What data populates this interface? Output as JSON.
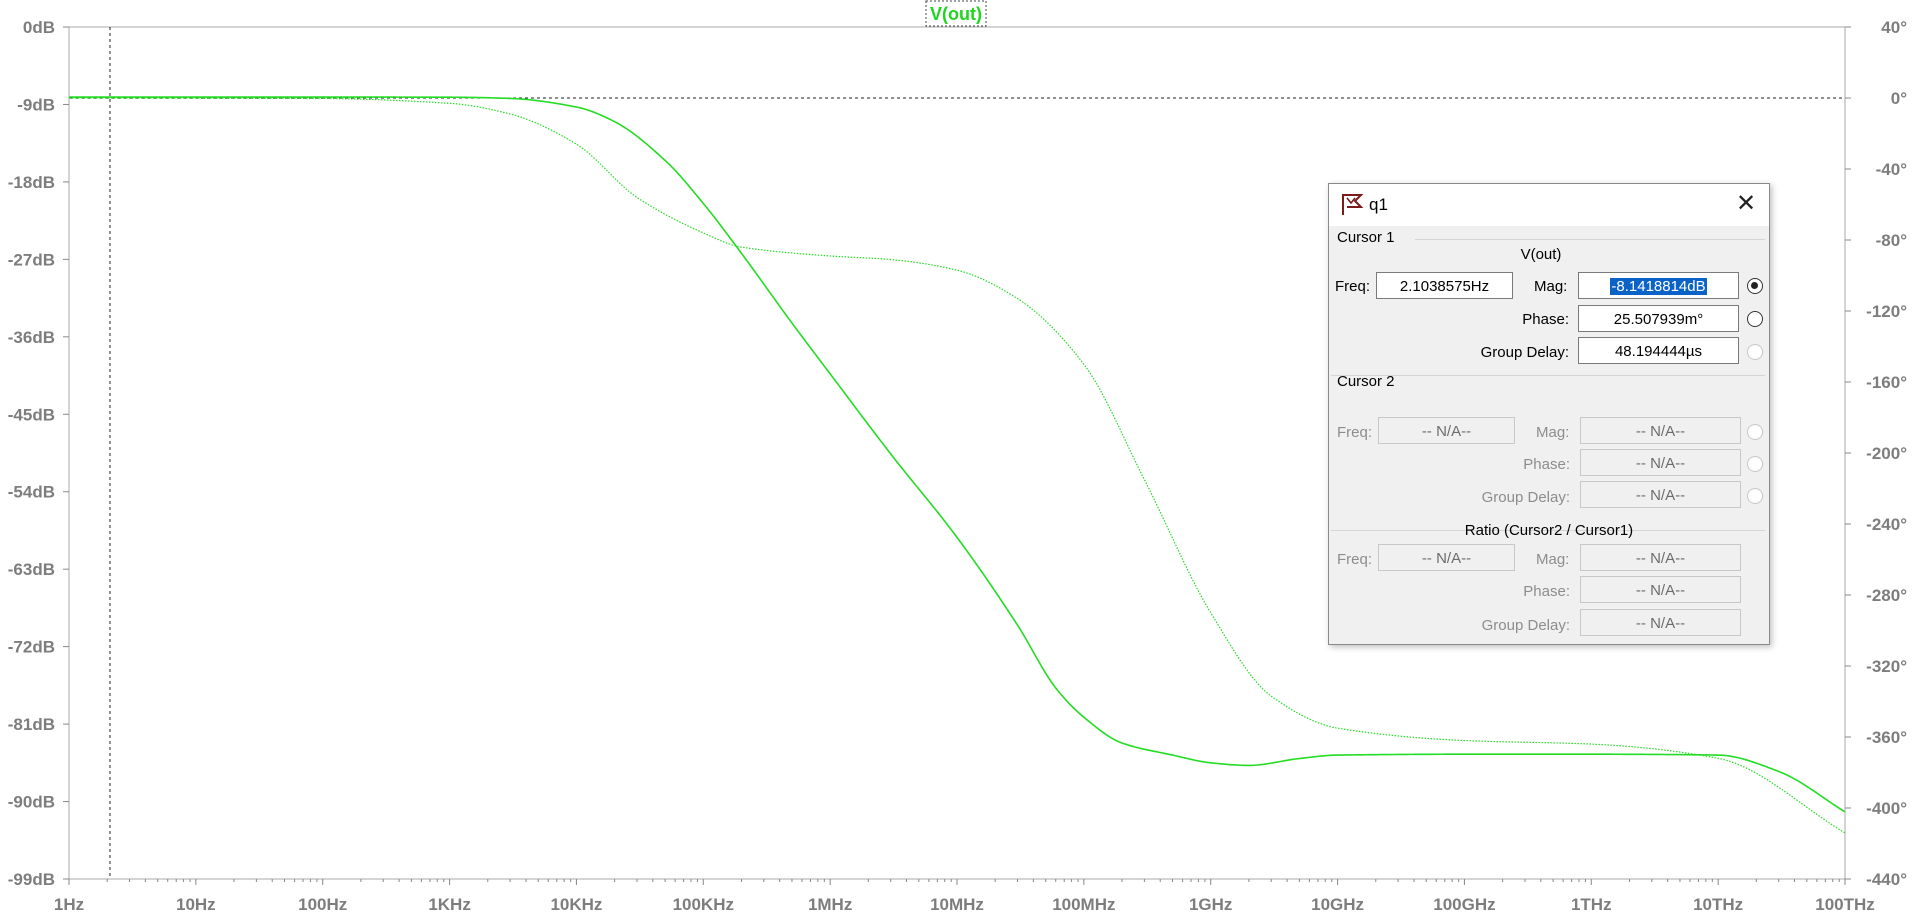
{
  "chart_data": {
    "type": "line",
    "title": "V(out)",
    "xscale": "log",
    "xlim": [
      1,
      100000000000000.0
    ],
    "x_ticks": [
      "1Hz",
      "10Hz",
      "100Hz",
      "1KHz",
      "10KHz",
      "100KHz",
      "1MHz",
      "10MHz",
      "100MHz",
      "1GHz",
      "10GHz",
      "100GHz",
      "1THz",
      "10THz",
      "100THz"
    ],
    "ylim_left": [
      -99,
      0
    ],
    "y_ticks_left": [
      "0dB",
      "-9dB",
      "-18dB",
      "-27dB",
      "-36dB",
      "-45dB",
      "-54dB",
      "-63dB",
      "-72dB",
      "-81dB",
      "-90dB",
      "-99dB"
    ],
    "ylim_right": [
      -440,
      40
    ],
    "y_ticks_right": [
      "40°",
      "0°",
      "-40°",
      "-80°",
      "-120°",
      "-160°",
      "-200°",
      "-240°",
      "-280°",
      "-320°",
      "-360°",
      "-400°",
      "-440°"
    ],
    "grid": false,
    "reference_line_right_deg": 0,
    "cursor_freq_hz": 2.1038575,
    "line_color": "#22dd22",
    "series": [
      {
        "axis": "left",
        "style": "solid",
        "x": [
          1,
          100,
          1000,
          3000,
          10000,
          20000,
          50000,
          100000,
          200000,
          500000,
          1000000,
          3000000,
          10000000,
          30000000,
          60000000,
          100000000,
          200000000,
          500000000,
          1000000000,
          2000000000,
          5000000000,
          10000000000,
          100000000000,
          1000000000000,
          10000000000000,
          30000000000000,
          100000000000000
        ],
        "values": [
          -8.14,
          -8.14,
          -8.16,
          -8.3,
          -9.3,
          -11.0,
          -15.5,
          -20.5,
          -26.3,
          -34.4,
          -40.3,
          -49.6,
          -59.3,
          -69.5,
          -76.8,
          -80.2,
          -83.2,
          -84.6,
          -85.5,
          -85.8,
          -85.0,
          -84.6,
          -84.5,
          -84.5,
          -84.6,
          -86.5,
          -91.2
        ]
      },
      {
        "axis": "right",
        "style": "dotted",
        "x": [
          1,
          100,
          1000,
          3000,
          10000,
          30000,
          100000,
          200000,
          1000000,
          3000000,
          10000000,
          30000000,
          100000000,
          300000000,
          1000000000,
          3000000000,
          10000000000,
          100000000000,
          1000000000000,
          10000000000000,
          100000000000000
        ],
        "values": [
          0.0,
          -0.3,
          -3.0,
          -9,
          -26,
          -56,
          -76,
          -84,
          -89,
          -91,
          -97,
          -113,
          -150,
          -215,
          -290,
          -337,
          -355,
          -362,
          -364,
          -372,
          -414
        ]
      }
    ]
  },
  "dialog": {
    "title": "q1",
    "close_glyph": "✕",
    "cursor1": {
      "section": "Cursor 1",
      "trace": "V(out)",
      "freq_label": "Freq:",
      "freq_value": "2.1038575Hz",
      "mag_label": "Mag:",
      "mag_value": "-8.1418814dB",
      "phase_label": "Phase:",
      "phase_value": "25.507939m°",
      "gd_label": "Group Delay:",
      "gd_value": "48.194444µs"
    },
    "cursor2": {
      "section": "Cursor 2",
      "freq_label": "Freq:",
      "freq_value": "-- N/A--",
      "mag_label": "Mag:",
      "mag_value": "-- N/A--",
      "phase_label": "Phase:",
      "phase_value": "-- N/A--",
      "gd_label": "Group Delay:",
      "gd_value": "-- N/A--"
    },
    "ratio": {
      "section": "Ratio (Cursor2 / Cursor1)",
      "freq_label": "Freq:",
      "freq_value": "-- N/A--",
      "mag_label": "Mag:",
      "mag_value": "-- N/A--",
      "phase_label": "Phase:",
      "phase_value": "-- N/A--",
      "gd_label": "Group Delay:",
      "gd_value": "-- N/A--"
    }
  }
}
